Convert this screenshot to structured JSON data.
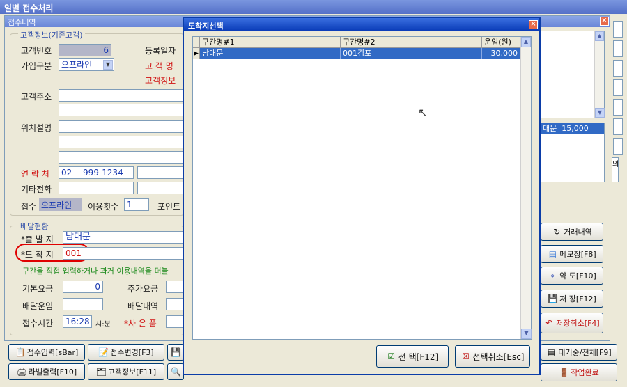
{
  "window": {
    "title": "일별 접수처리"
  },
  "inner": {
    "title": "접수내역"
  },
  "customer": {
    "legend": "고객정보(기존고객)",
    "id_label": "고객번호",
    "id_value": "6",
    "join_label": "가입구분",
    "join_value": "오프라인",
    "reg_label": "등록일자",
    "name_label": "고 객 명",
    "info_label": "고객정보",
    "address_label": "고객주소",
    "location_label": "위치설명",
    "contact_label": "연 락 처",
    "contact_value": "02   -999-1234",
    "other_phone_label": "기타전화",
    "receipt_label": "접수",
    "receipt_value": "오프라인",
    "usage_label": "이용횟수",
    "usage_value": "1",
    "point_label": "포인트"
  },
  "delivery": {
    "legend": "배달현황",
    "origin_label": "*출 발 지",
    "origin_value": "남대문",
    "dest_label": "*도 착 지",
    "dest_value": "001",
    "hint": "구간을 직접 입력하거나 과거 이용내역을 더블",
    "base_fee_label": "기본요금",
    "base_fee_value": "0",
    "extra_fee_label": "추가요금",
    "delivery_fare_label": "배달운임",
    "delivery_detail_label": "배달내역",
    "time_label": "접수시간",
    "time_value": "16:28",
    "time_unit": "시:분",
    "item_label": "*사 은 품"
  },
  "right_panel": {
    "list_item": "대문  15,000",
    "buttons": {
      "history": "거래내역",
      "memo": "메모장[F8]",
      "map": "약 도[F10]",
      "save": "저 장[F12]",
      "cancel_save": "저장취소[F4]"
    },
    "tab_fragment": "의"
  },
  "bottom": {
    "row1": {
      "receive": "접수입력[sBar]",
      "change": "접수변경[F3]",
      "wait": "대기중/전체[F9]"
    },
    "row2": {
      "label_print": "라벨출력[F10]",
      "customer_info": "고객정보[F11]",
      "done": "작업완료"
    }
  },
  "dialog": {
    "title": "도착지선택",
    "columns": [
      "구간명#1",
      "구간명#2",
      "운임(원)"
    ],
    "rows": [
      {
        "c1": "남대문",
        "c2": "001김포",
        "c3": "30,000"
      }
    ],
    "select_button": "선 택[F12]",
    "cancel_button": "선택취소[Esc]"
  },
  "colors": {
    "title_bar": "#0a3cb8",
    "selection": "#316ac5",
    "label_red": "#d01010",
    "value_blue": "#1a3ab0"
  }
}
